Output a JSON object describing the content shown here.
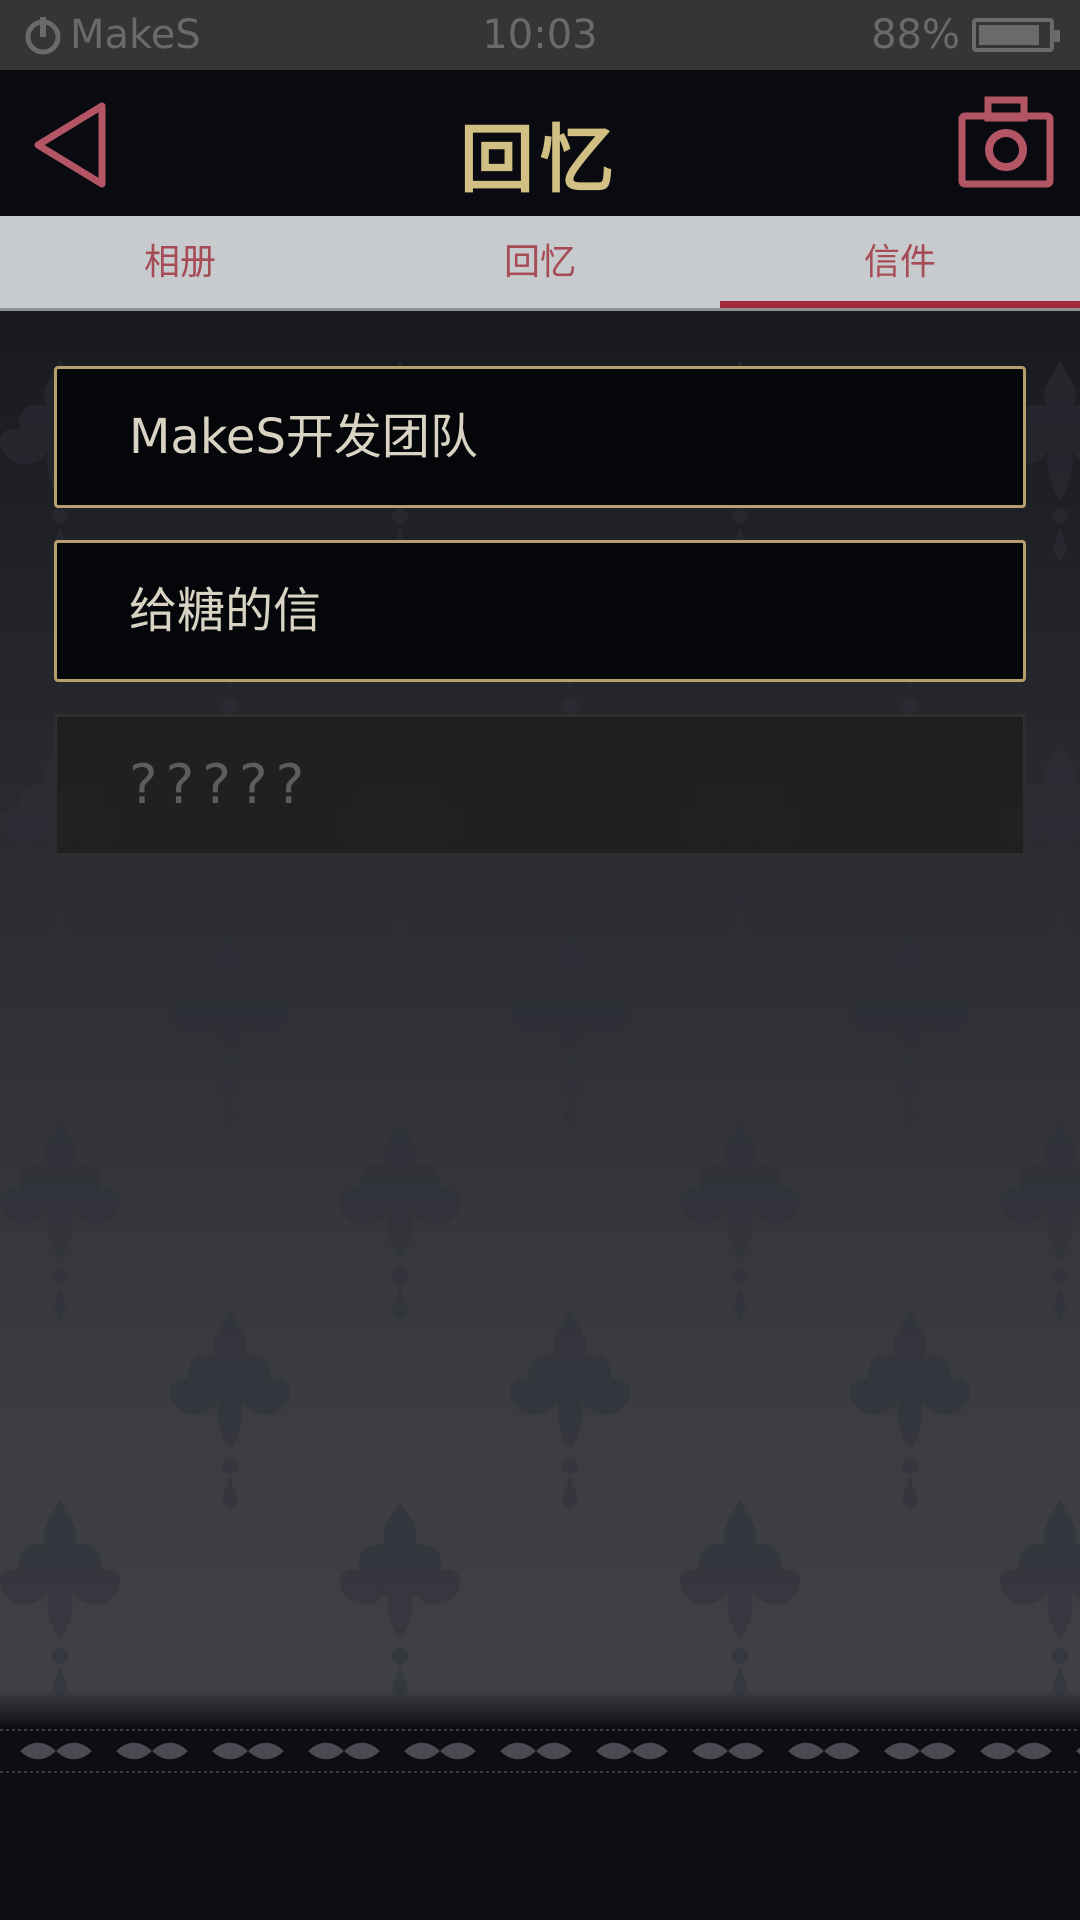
{
  "status_bar": {
    "carrier": "MakeS",
    "time": "10:03",
    "battery_percent": "88%",
    "battery_level": 0.88
  },
  "header": {
    "title": "回忆",
    "back_icon": "triangle-back-icon",
    "camera_icon": "camera-icon"
  },
  "tabs": [
    {
      "label": "相册",
      "active": false
    },
    {
      "label": "回忆",
      "active": false
    },
    {
      "label": "信件",
      "active": true
    }
  ],
  "letters": [
    {
      "title": "MakeS开发团队",
      "locked": false
    },
    {
      "title": "给糖的信",
      "locked": false
    },
    {
      "title": "?????",
      "locked": true
    }
  ],
  "colors": {
    "title_gold": "#d2bf83",
    "accent_red": "#9e2a3a",
    "tab_text": "#a64c57",
    "card_border": "#b59f6e"
  }
}
